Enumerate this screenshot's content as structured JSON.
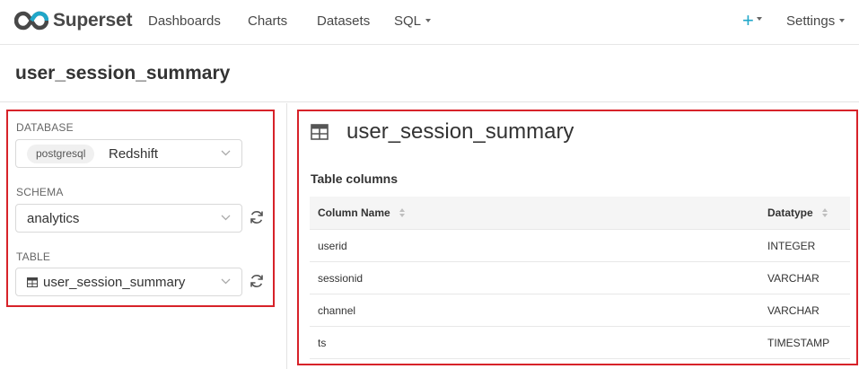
{
  "app": {
    "name": "Superset"
  },
  "nav": {
    "items": [
      "Dashboards",
      "Charts",
      "Datasets",
      "SQL"
    ],
    "plus_label": "+",
    "settings_label": "Settings"
  },
  "page": {
    "title": "user_session_summary"
  },
  "left": {
    "database": {
      "label": "DATABASE",
      "tag": "postgresql",
      "value": "Redshift"
    },
    "schema": {
      "label": "SCHEMA",
      "value": "analytics"
    },
    "table": {
      "label": "TABLE",
      "value": "user_session_summary"
    }
  },
  "right": {
    "title": "user_session_summary",
    "section": "Table columns",
    "columns": [
      "Column Name",
      "Datatype"
    ],
    "rows": [
      {
        "name": "userid",
        "type": "INTEGER"
      },
      {
        "name": "sessionid",
        "type": "VARCHAR"
      },
      {
        "name": "channel",
        "type": "VARCHAR"
      },
      {
        "name": "ts",
        "type": "TIMESTAMP"
      }
    ]
  },
  "colors": {
    "accent": "#20a7c9",
    "highlight": "#d72229"
  },
  "icons": [
    "superset-logo-icon",
    "caret-down-icon",
    "chevron-down-icon",
    "refresh-icon",
    "table-icon",
    "sort-icon"
  ]
}
